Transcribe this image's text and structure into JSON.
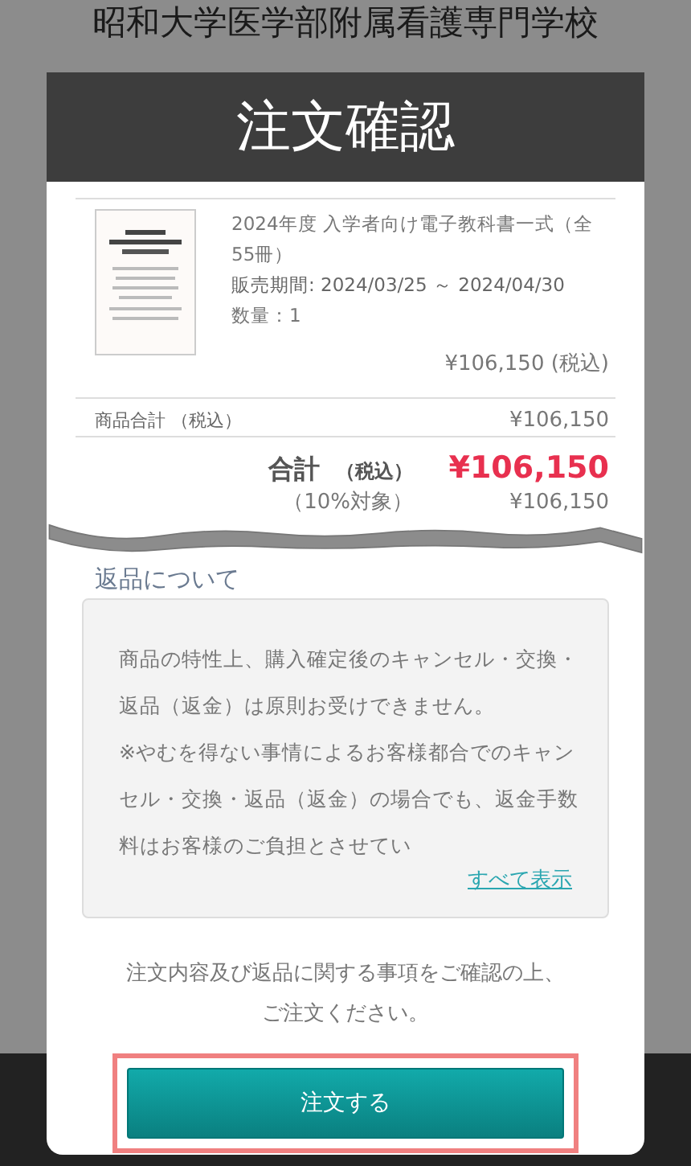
{
  "page": {
    "title": "昭和大学医学部附属看護専門学校"
  },
  "modal": {
    "title": "注文確認",
    "item": {
      "name": "2024年度 入学者向け電子教科書一式（全55冊）",
      "period_label": "販売期間:",
      "period": "2024/03/25 ～ 2024/04/30",
      "quantity": "数量：1",
      "price": "¥106,150 (税込)"
    },
    "subtotal": {
      "label": "商品合計 （税込）",
      "value": "¥106,150"
    },
    "total": {
      "label": "合計",
      "tax_label": "（税込）",
      "value": "¥106,150"
    },
    "tax_rate": {
      "label": "（10%対象）",
      "value": "¥106,150"
    },
    "returns": {
      "heading": "返品について",
      "text": "商品の特性上、購入確定後のキャンセル・交換・返品（返金）は原則お受けできません。\n※やむを得ない事情によるお客様都合でのキャンセル・交換・返品（返金）の場合でも、返金手数料はお客様のご負担とさせてい",
      "show_all": "すべて表示"
    },
    "notice": "注文内容及び返品に関する事項をご確認の上、ご注文ください。",
    "order_button": {
      "label": "注文する",
      "highlighted": true
    }
  }
}
